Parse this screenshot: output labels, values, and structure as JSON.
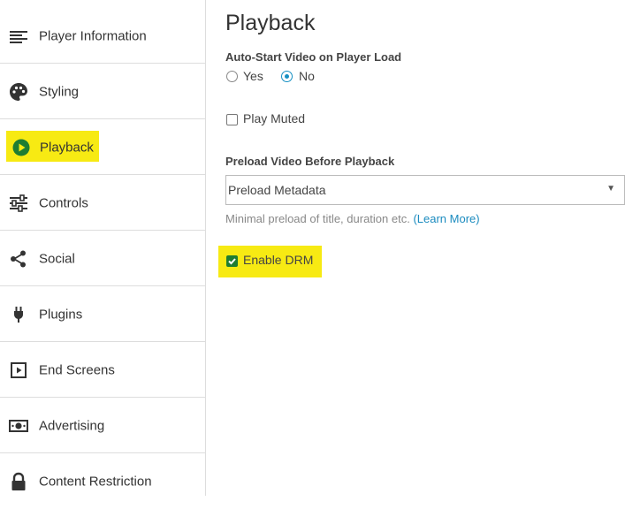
{
  "sidebar": {
    "items": [
      {
        "label": "Player Information",
        "icon": "list-icon"
      },
      {
        "label": "Styling",
        "icon": "palette-icon"
      },
      {
        "label": "Playback",
        "icon": "play-circle-icon",
        "active": true
      },
      {
        "label": "Controls",
        "icon": "sliders-icon"
      },
      {
        "label": "Social",
        "icon": "share-icon"
      },
      {
        "label": "Plugins",
        "icon": "plug-icon"
      },
      {
        "label": "End Screens",
        "icon": "play-square-icon"
      },
      {
        "label": "Advertising",
        "icon": "money-icon"
      },
      {
        "label": "Content Restriction",
        "icon": "lock-icon"
      }
    ]
  },
  "main": {
    "title": "Playback",
    "autostart": {
      "label": "Auto-Start Video on Player Load",
      "options": [
        "Yes",
        "No"
      ],
      "selected": "No"
    },
    "play_muted": {
      "label": "Play Muted",
      "checked": false
    },
    "preload": {
      "label": "Preload Video Before Playback",
      "value": "Preload Metadata",
      "help": "Minimal preload of title, duration etc.",
      "learn_more": "(Learn More)"
    },
    "drm": {
      "label": "Enable DRM",
      "checked": true
    }
  },
  "colors": {
    "highlight": "#f7ea13",
    "accent": "#1790c3",
    "check": "#1e7d32"
  }
}
